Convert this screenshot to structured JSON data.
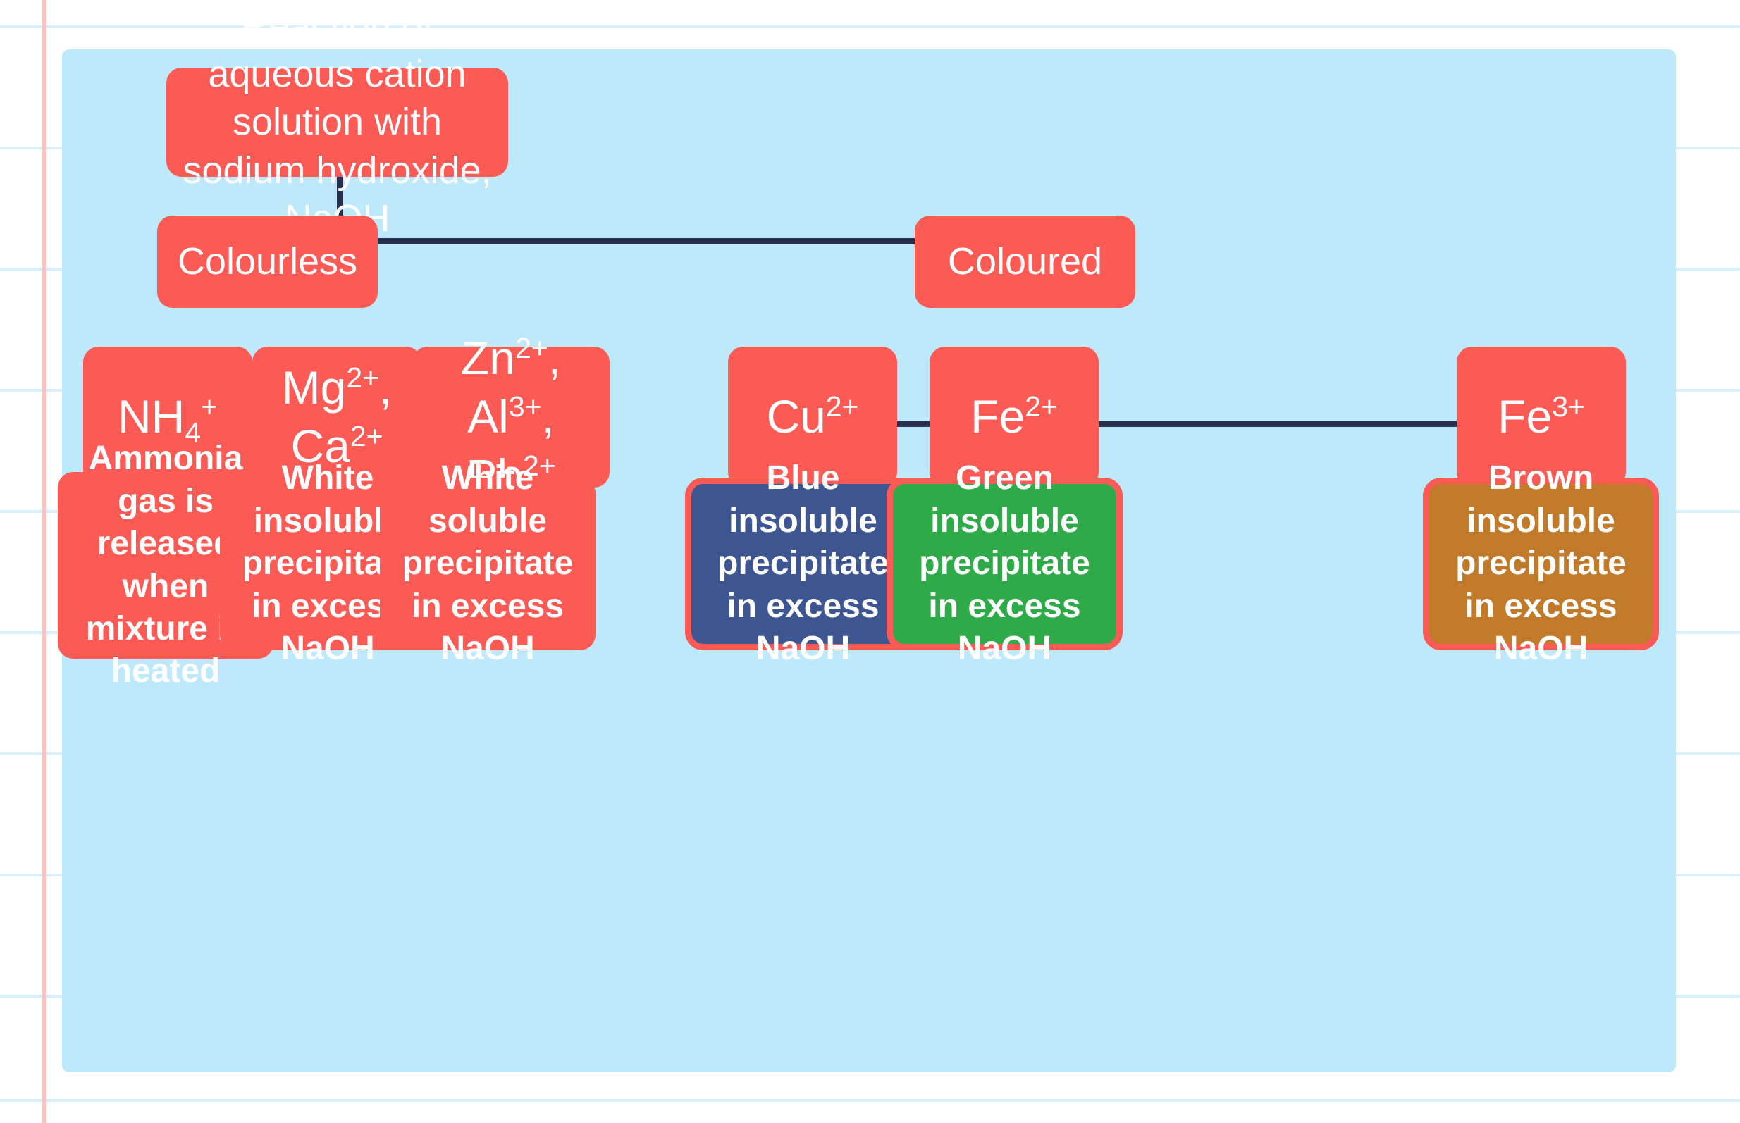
{
  "page": {
    "background_color": "#ffffff",
    "rule_color": "#d7f0fc",
    "margin_line_color": "#fbc3c0"
  },
  "diagram": {
    "type": "flowchart",
    "canvas_color": "#bde9fb",
    "connector_color": "#27304f",
    "default_node_color": "#fc5a54",
    "default_text_color": "#ffffff",
    "title": "Reaction of aqueous cation solution with sodium hydroxide, NaOH",
    "root": {
      "id": "root",
      "label": "Reaction of aqueous cation solution with sodium hydroxide, NaOH",
      "color": "#fc5a54"
    },
    "branches": [
      {
        "id": "colourless",
        "label": "Colourless",
        "color": "#fc5a54"
      },
      {
        "id": "coloured",
        "label": "Coloured",
        "color": "#fc5a54"
      }
    ],
    "cations": [
      {
        "id": "nh4",
        "label": "NH4+",
        "html": "NH<sub>4</sub><sup>+</sup>",
        "branch": "colourless",
        "color": "#fc5a54"
      },
      {
        "id": "mg-ca",
        "label": "Mg2+, Ca2+",
        "html": "Mg<sup>2+</sup>,<br>Ca<sup>2+</sup>",
        "branch": "colourless",
        "color": "#fc5a54"
      },
      {
        "id": "zn-al-pb",
        "label": "Zn2+, Al3+, Pb2+",
        "html": "Zn<sup>2+</sup>,<br>Al<sup>3+</sup>, Pb<sup>2+</sup>",
        "branch": "colourless",
        "color": "#fc5a54"
      },
      {
        "id": "cu",
        "label": "Cu2+",
        "html": "Cu<sup>2+</sup>",
        "branch": "coloured",
        "color": "#fc5a54"
      },
      {
        "id": "fe2",
        "label": "Fe2+",
        "html": "Fe<sup>2+</sup>",
        "branch": "coloured",
        "color": "#fc5a54"
      },
      {
        "id": "fe3",
        "label": "Fe3+",
        "html": "Fe<sup>3+</sup>",
        "branch": "coloured",
        "color": "#fc5a54"
      }
    ],
    "observations": [
      {
        "id": "obs-nh4",
        "cation": "nh4",
        "label": "Ammonia gas is released when mixture is heated",
        "fill_color": "#fc5a54",
        "border_color": "#fc5a54",
        "outlined": false
      },
      {
        "id": "obs-mg-ca",
        "cation": "mg-ca",
        "label": "White insoluble precipitate in excess NaOH",
        "fill_color": "#fc5a54",
        "border_color": "#fc5a54",
        "outlined": false
      },
      {
        "id": "obs-zn-al-pb",
        "cation": "zn-al-pb",
        "label": "White soluble precipitate in excess NaOH",
        "fill_color": "#fc5a54",
        "border_color": "#fc5a54",
        "outlined": false
      },
      {
        "id": "obs-cu",
        "cation": "cu",
        "label": "Blue insoluble precipitate in excess NaOH",
        "fill_color": "#3d5691",
        "border_color": "#fc5a54",
        "outlined": true
      },
      {
        "id": "obs-fe2",
        "cation": "fe2",
        "label": "Green insoluble precipitate in excess NaOH",
        "fill_color": "#2faa49",
        "border_color": "#fc5a54",
        "outlined": true
      },
      {
        "id": "obs-fe3",
        "cation": "fe3",
        "label": "Brown insoluble precipitate in excess NaOH",
        "fill_color": "#c07a2a",
        "border_color": "#fc5a54",
        "outlined": true
      }
    ]
  }
}
